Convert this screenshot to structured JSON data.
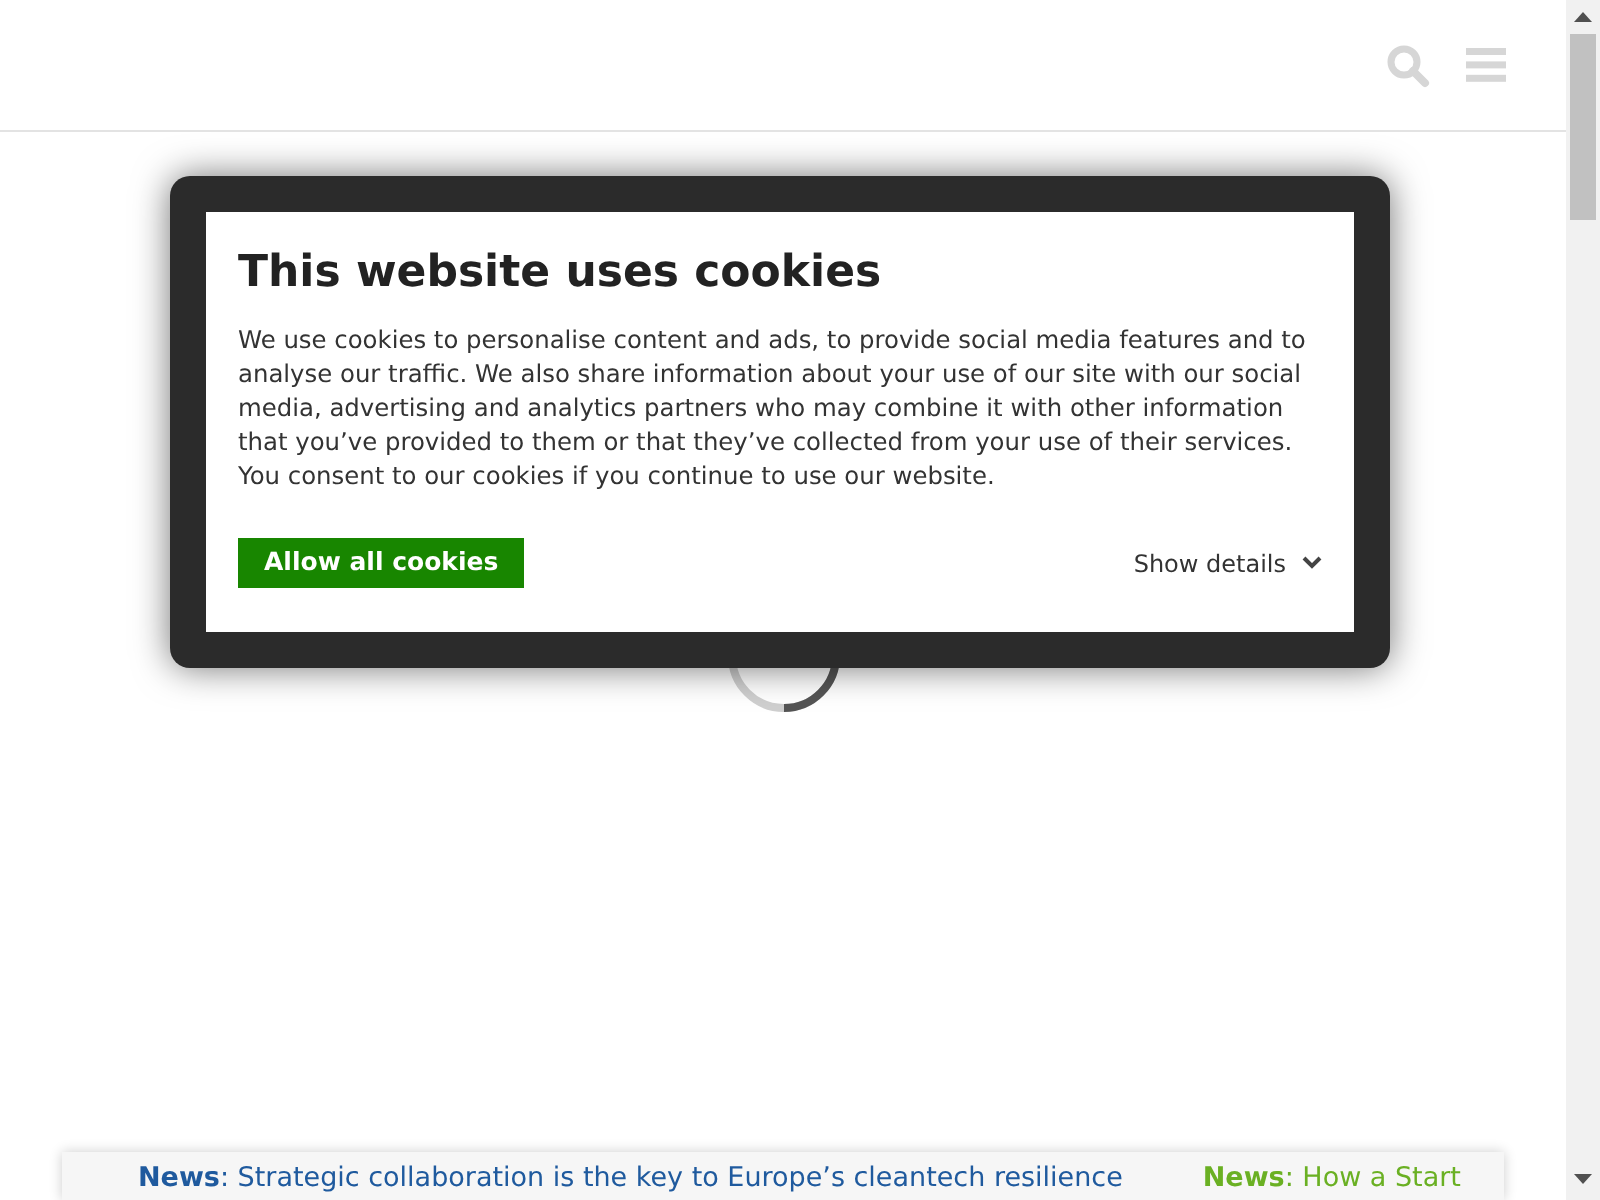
{
  "cookie_dialog": {
    "title": "This website uses cookies",
    "text": "We use cookies to personalise content and ads, to provide social media features and to analyse our traffic. We also share information about your use of our site with our social media, advertising and analytics partners who may combine it with other information that you’ve provided to them or that they’ve collected from your use of their services. You consent to our cookies if you continue to use our website.",
    "allow_button": "Allow all cookies",
    "details_link": "Show details"
  },
  "news_ticker": [
    {
      "text": "**News**: Strategic collaboration is the key to Europe’s cleantech resilience",
      "color": "#1f5a9e"
    },
    {
      "text": "**News**: How a Start",
      "color": "#6ab023"
    }
  ]
}
